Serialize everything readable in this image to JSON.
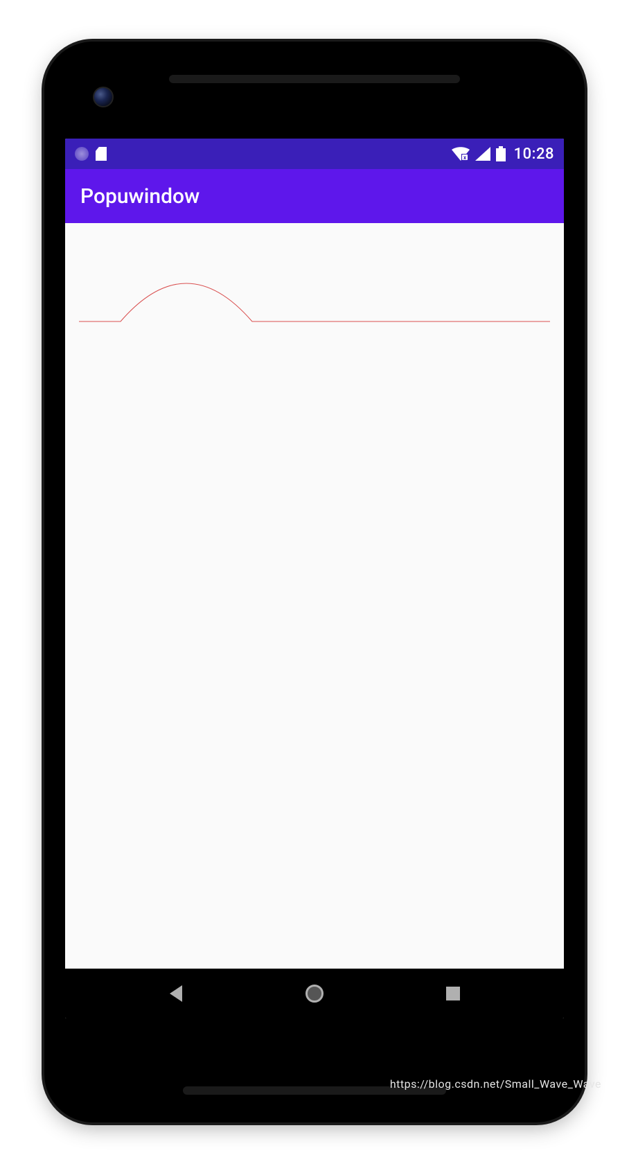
{
  "status_bar": {
    "time": "10:28"
  },
  "app_bar": {
    "title": "Popuwindow"
  },
  "colors": {
    "status_bar_bg": "#3a1fb8",
    "app_bar_bg": "#5e17eb",
    "curve_stroke": "#d94f4f"
  },
  "watermark": "https://blog.csdn.net/Small_Wave_Wave"
}
